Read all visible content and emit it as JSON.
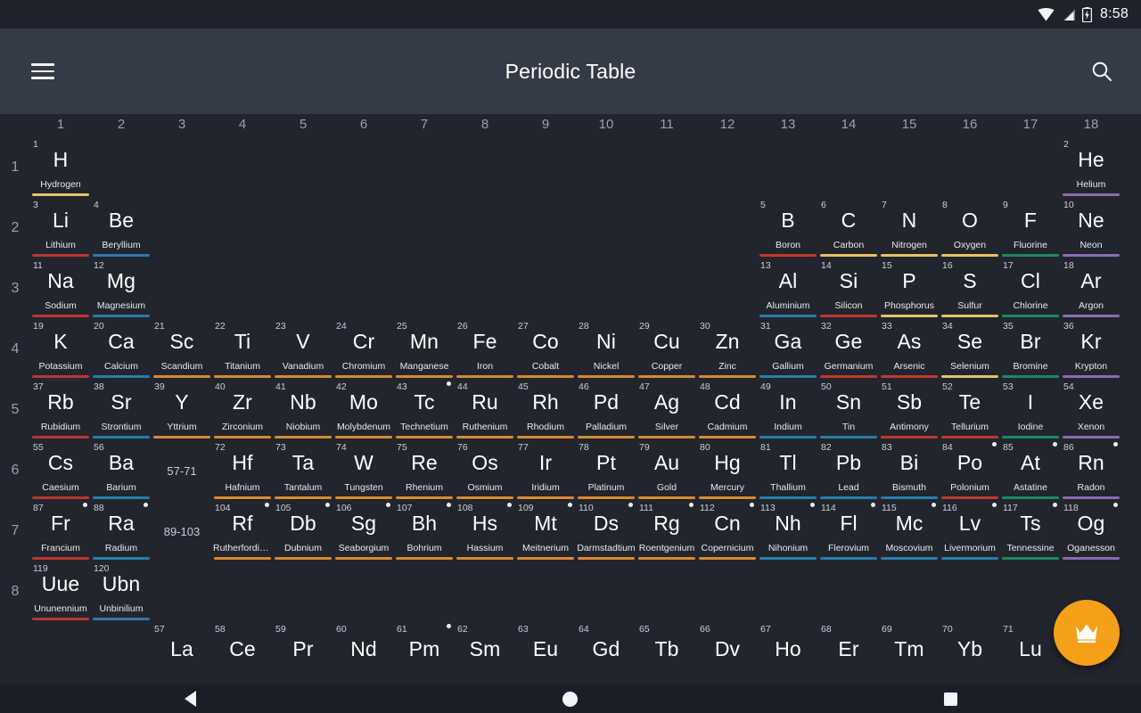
{
  "status_bar": {
    "time": "8:58",
    "icons": [
      "wifi-icon",
      "cell-signal-icon",
      "battery-charging-icon"
    ]
  },
  "app_bar": {
    "title": "Periodic Table",
    "menu_icon": "hamburger-menu-icon",
    "search_icon": "search-icon"
  },
  "fab": {
    "icon": "crown-icon",
    "color": "#f5a019"
  },
  "nav_bar": {
    "back": "back-icon",
    "home": "home-icon",
    "recents": "recents-icon"
  },
  "table": {
    "group_headers": [
      "1",
      "2",
      "3",
      "4",
      "5",
      "6",
      "7",
      "8",
      "9",
      "10",
      "11",
      "12",
      "13",
      "14",
      "15",
      "16",
      "17",
      "18"
    ],
    "period_labels": [
      "1",
      "2",
      "3",
      "4",
      "5",
      "6",
      "7",
      "8"
    ],
    "range_cells": [
      {
        "label": "57-71",
        "period": 6,
        "group": 3
      },
      {
        "label": "89-103",
        "period": 7,
        "group": 3
      }
    ],
    "category_colors": {
      "alkali-metal": "#b8372f",
      "alkaline-earth-metal": "#2b7ba8",
      "transition-metal": "#d68a33",
      "post-transition-metal": "#2b7ba8",
      "metalloid": "#c0392b",
      "nonmetal": "#e3c463",
      "halogen": "#1c8a5e",
      "noble-gas": "#8a6bb0",
      "unknown": "#555b69"
    },
    "elements": [
      {
        "n": 1,
        "sym": "H",
        "name": "Hydrogen",
        "p": 1,
        "g": 1,
        "cat": "nonmetal"
      },
      {
        "n": 2,
        "sym": "He",
        "name": "Helium",
        "p": 1,
        "g": 18,
        "cat": "noble-gas"
      },
      {
        "n": 3,
        "sym": "Li",
        "name": "Lithium",
        "p": 2,
        "g": 1,
        "cat": "alkali-metal"
      },
      {
        "n": 4,
        "sym": "Be",
        "name": "Beryllium",
        "p": 2,
        "g": 2,
        "cat": "alkaline-earth-metal"
      },
      {
        "n": 5,
        "sym": "B",
        "name": "Boron",
        "p": 2,
        "g": 13,
        "cat": "metalloid"
      },
      {
        "n": 6,
        "sym": "C",
        "name": "Carbon",
        "p": 2,
        "g": 14,
        "cat": "nonmetal"
      },
      {
        "n": 7,
        "sym": "N",
        "name": "Nitrogen",
        "p": 2,
        "g": 15,
        "cat": "nonmetal"
      },
      {
        "n": 8,
        "sym": "O",
        "name": "Oxygen",
        "p": 2,
        "g": 16,
        "cat": "nonmetal"
      },
      {
        "n": 9,
        "sym": "F",
        "name": "Fluorine",
        "p": 2,
        "g": 17,
        "cat": "halogen"
      },
      {
        "n": 10,
        "sym": "Ne",
        "name": "Neon",
        "p": 2,
        "g": 18,
        "cat": "noble-gas"
      },
      {
        "n": 11,
        "sym": "Na",
        "name": "Sodium",
        "p": 3,
        "g": 1,
        "cat": "alkali-metal"
      },
      {
        "n": 12,
        "sym": "Mg",
        "name": "Magnesium",
        "p": 3,
        "g": 2,
        "cat": "alkaline-earth-metal"
      },
      {
        "n": 13,
        "sym": "Al",
        "name": "Aluminium",
        "p": 3,
        "g": 13,
        "cat": "post-transition-metal"
      },
      {
        "n": 14,
        "sym": "Si",
        "name": "Silicon",
        "p": 3,
        "g": 14,
        "cat": "metalloid"
      },
      {
        "n": 15,
        "sym": "P",
        "name": "Phosphorus",
        "p": 3,
        "g": 15,
        "cat": "nonmetal"
      },
      {
        "n": 16,
        "sym": "S",
        "name": "Sulfur",
        "p": 3,
        "g": 16,
        "cat": "nonmetal"
      },
      {
        "n": 17,
        "sym": "Cl",
        "name": "Chlorine",
        "p": 3,
        "g": 17,
        "cat": "halogen"
      },
      {
        "n": 18,
        "sym": "Ar",
        "name": "Argon",
        "p": 3,
        "g": 18,
        "cat": "noble-gas"
      },
      {
        "n": 19,
        "sym": "K",
        "name": "Potassium",
        "p": 4,
        "g": 1,
        "cat": "alkali-metal"
      },
      {
        "n": 20,
        "sym": "Ca",
        "name": "Calcium",
        "p": 4,
        "g": 2,
        "cat": "alkaline-earth-metal"
      },
      {
        "n": 21,
        "sym": "Sc",
        "name": "Scandium",
        "p": 4,
        "g": 3,
        "cat": "transition-metal"
      },
      {
        "n": 22,
        "sym": "Ti",
        "name": "Titanium",
        "p": 4,
        "g": 4,
        "cat": "transition-metal"
      },
      {
        "n": 23,
        "sym": "V",
        "name": "Vanadium",
        "p": 4,
        "g": 5,
        "cat": "transition-metal"
      },
      {
        "n": 24,
        "sym": "Cr",
        "name": "Chromium",
        "p": 4,
        "g": 6,
        "cat": "transition-metal"
      },
      {
        "n": 25,
        "sym": "Mn",
        "name": "Manganese",
        "p": 4,
        "g": 7,
        "cat": "transition-metal"
      },
      {
        "n": 26,
        "sym": "Fe",
        "name": "Iron",
        "p": 4,
        "g": 8,
        "cat": "transition-metal"
      },
      {
        "n": 27,
        "sym": "Co",
        "name": "Cobalt",
        "p": 4,
        "g": 9,
        "cat": "transition-metal"
      },
      {
        "n": 28,
        "sym": "Ni",
        "name": "Nickel",
        "p": 4,
        "g": 10,
        "cat": "transition-metal"
      },
      {
        "n": 29,
        "sym": "Cu",
        "name": "Copper",
        "p": 4,
        "g": 11,
        "cat": "transition-metal"
      },
      {
        "n": 30,
        "sym": "Zn",
        "name": "Zinc",
        "p": 4,
        "g": 12,
        "cat": "transition-metal"
      },
      {
        "n": 31,
        "sym": "Ga",
        "name": "Gallium",
        "p": 4,
        "g": 13,
        "cat": "post-transition-metal"
      },
      {
        "n": 32,
        "sym": "Ge",
        "name": "Germanium",
        "p": 4,
        "g": 14,
        "cat": "metalloid"
      },
      {
        "n": 33,
        "sym": "As",
        "name": "Arsenic",
        "p": 4,
        "g": 15,
        "cat": "metalloid"
      },
      {
        "n": 34,
        "sym": "Se",
        "name": "Selenium",
        "p": 4,
        "g": 16,
        "cat": "nonmetal"
      },
      {
        "n": 35,
        "sym": "Br",
        "name": "Bromine",
        "p": 4,
        "g": 17,
        "cat": "halogen"
      },
      {
        "n": 36,
        "sym": "Kr",
        "name": "Krypton",
        "p": 4,
        "g": 18,
        "cat": "noble-gas"
      },
      {
        "n": 37,
        "sym": "Rb",
        "name": "Rubidium",
        "p": 5,
        "g": 1,
        "cat": "alkali-metal"
      },
      {
        "n": 38,
        "sym": "Sr",
        "name": "Strontium",
        "p": 5,
        "g": 2,
        "cat": "alkaline-earth-metal"
      },
      {
        "n": 39,
        "sym": "Y",
        "name": "Yttrium",
        "p": 5,
        "g": 3,
        "cat": "transition-metal"
      },
      {
        "n": 40,
        "sym": "Zr",
        "name": "Zirconium",
        "p": 5,
        "g": 4,
        "cat": "transition-metal"
      },
      {
        "n": 41,
        "sym": "Nb",
        "name": "Niobium",
        "p": 5,
        "g": 5,
        "cat": "transition-metal"
      },
      {
        "n": 42,
        "sym": "Mo",
        "name": "Molybdenum",
        "p": 5,
        "g": 6,
        "cat": "transition-metal"
      },
      {
        "n": 43,
        "sym": "Tc",
        "name": "Technetium",
        "p": 5,
        "g": 7,
        "cat": "transition-metal",
        "rad": true
      },
      {
        "n": 44,
        "sym": "Ru",
        "name": "Ruthenium",
        "p": 5,
        "g": 8,
        "cat": "transition-metal"
      },
      {
        "n": 45,
        "sym": "Rh",
        "name": "Rhodium",
        "p": 5,
        "g": 9,
        "cat": "transition-metal"
      },
      {
        "n": 46,
        "sym": "Pd",
        "name": "Palladium",
        "p": 5,
        "g": 10,
        "cat": "transition-metal"
      },
      {
        "n": 47,
        "sym": "Ag",
        "name": "Silver",
        "p": 5,
        "g": 11,
        "cat": "transition-metal"
      },
      {
        "n": 48,
        "sym": "Cd",
        "name": "Cadmium",
        "p": 5,
        "g": 12,
        "cat": "transition-metal"
      },
      {
        "n": 49,
        "sym": "In",
        "name": "Indium",
        "p": 5,
        "g": 13,
        "cat": "post-transition-metal"
      },
      {
        "n": 50,
        "sym": "Sn",
        "name": "Tin",
        "p": 5,
        "g": 14,
        "cat": "post-transition-metal"
      },
      {
        "n": 51,
        "sym": "Sb",
        "name": "Antimony",
        "p": 5,
        "g": 15,
        "cat": "metalloid"
      },
      {
        "n": 52,
        "sym": "Te",
        "name": "Tellurium",
        "p": 5,
        "g": 16,
        "cat": "metalloid"
      },
      {
        "n": 53,
        "sym": "I",
        "name": "Iodine",
        "p": 5,
        "g": 17,
        "cat": "halogen"
      },
      {
        "n": 54,
        "sym": "Xe",
        "name": "Xenon",
        "p": 5,
        "g": 18,
        "cat": "noble-gas"
      },
      {
        "n": 55,
        "sym": "Cs",
        "name": "Caesium",
        "p": 6,
        "g": 1,
        "cat": "alkali-metal"
      },
      {
        "n": 56,
        "sym": "Ba",
        "name": "Barium",
        "p": 6,
        "g": 2,
        "cat": "alkaline-earth-metal"
      },
      {
        "n": 72,
        "sym": "Hf",
        "name": "Hafnium",
        "p": 6,
        "g": 4,
        "cat": "transition-metal"
      },
      {
        "n": 73,
        "sym": "Ta",
        "name": "Tantalum",
        "p": 6,
        "g": 5,
        "cat": "transition-metal"
      },
      {
        "n": 74,
        "sym": "W",
        "name": "Tungsten",
        "p": 6,
        "g": 6,
        "cat": "transition-metal"
      },
      {
        "n": 75,
        "sym": "Re",
        "name": "Rhenium",
        "p": 6,
        "g": 7,
        "cat": "transition-metal"
      },
      {
        "n": 76,
        "sym": "Os",
        "name": "Osmium",
        "p": 6,
        "g": 8,
        "cat": "transition-metal"
      },
      {
        "n": 77,
        "sym": "Ir",
        "name": "Iridium",
        "p": 6,
        "g": 9,
        "cat": "transition-metal"
      },
      {
        "n": 78,
        "sym": "Pt",
        "name": "Platinum",
        "p": 6,
        "g": 10,
        "cat": "transition-metal"
      },
      {
        "n": 79,
        "sym": "Au",
        "name": "Gold",
        "p": 6,
        "g": 11,
        "cat": "transition-metal"
      },
      {
        "n": 80,
        "sym": "Hg",
        "name": "Mercury",
        "p": 6,
        "g": 12,
        "cat": "transition-metal"
      },
      {
        "n": 81,
        "sym": "Tl",
        "name": "Thallium",
        "p": 6,
        "g": 13,
        "cat": "post-transition-metal"
      },
      {
        "n": 82,
        "sym": "Pb",
        "name": "Lead",
        "p": 6,
        "g": 14,
        "cat": "post-transition-metal"
      },
      {
        "n": 83,
        "sym": "Bi",
        "name": "Bismuth",
        "p": 6,
        "g": 15,
        "cat": "post-transition-metal"
      },
      {
        "n": 84,
        "sym": "Po",
        "name": "Polonium",
        "p": 6,
        "g": 16,
        "cat": "metalloid",
        "rad": true
      },
      {
        "n": 85,
        "sym": "At",
        "name": "Astatine",
        "p": 6,
        "g": 17,
        "cat": "halogen",
        "rad": true
      },
      {
        "n": 86,
        "sym": "Rn",
        "name": "Radon",
        "p": 6,
        "g": 18,
        "cat": "noble-gas",
        "rad": true
      },
      {
        "n": 87,
        "sym": "Fr",
        "name": "Francium",
        "p": 7,
        "g": 1,
        "cat": "alkali-metal",
        "rad": true
      },
      {
        "n": 88,
        "sym": "Ra",
        "name": "Radium",
        "p": 7,
        "g": 2,
        "cat": "alkaline-earth-metal",
        "rad": true
      },
      {
        "n": 104,
        "sym": "Rf",
        "name": "Rutherfordium",
        "p": 7,
        "g": 4,
        "cat": "transition-metal",
        "rad": true
      },
      {
        "n": 105,
        "sym": "Db",
        "name": "Dubnium",
        "p": 7,
        "g": 5,
        "cat": "transition-metal",
        "rad": true
      },
      {
        "n": 106,
        "sym": "Sg",
        "name": "Seaborgium",
        "p": 7,
        "g": 6,
        "cat": "transition-metal",
        "rad": true
      },
      {
        "n": 107,
        "sym": "Bh",
        "name": "Bohrium",
        "p": 7,
        "g": 7,
        "cat": "transition-metal",
        "rad": true
      },
      {
        "n": 108,
        "sym": "Hs",
        "name": "Hassium",
        "p": 7,
        "g": 8,
        "cat": "transition-metal",
        "rad": true
      },
      {
        "n": 109,
        "sym": "Mt",
        "name": "Meitnerium",
        "p": 7,
        "g": 9,
        "cat": "transition-metal",
        "rad": true
      },
      {
        "n": 110,
        "sym": "Ds",
        "name": "Darmstadtium",
        "p": 7,
        "g": 10,
        "cat": "transition-metal",
        "rad": true
      },
      {
        "n": 111,
        "sym": "Rg",
        "name": "Roentgenium",
        "p": 7,
        "g": 11,
        "cat": "transition-metal",
        "rad": true
      },
      {
        "n": 112,
        "sym": "Cn",
        "name": "Copernicium",
        "p": 7,
        "g": 12,
        "cat": "transition-metal",
        "rad": true
      },
      {
        "n": 113,
        "sym": "Nh",
        "name": "Nihonium",
        "p": 7,
        "g": 13,
        "cat": "post-transition-metal",
        "rad": true
      },
      {
        "n": 114,
        "sym": "Fl",
        "name": "Flerovium",
        "p": 7,
        "g": 14,
        "cat": "post-transition-metal",
        "rad": true
      },
      {
        "n": 115,
        "sym": "Mc",
        "name": "Moscovium",
        "p": 7,
        "g": 15,
        "cat": "post-transition-metal",
        "rad": true
      },
      {
        "n": 116,
        "sym": "Lv",
        "name": "Livermorium",
        "p": 7,
        "g": 16,
        "cat": "post-transition-metal",
        "rad": true
      },
      {
        "n": 117,
        "sym": "Ts",
        "name": "Tennessine",
        "p": 7,
        "g": 17,
        "cat": "halogen",
        "rad": true
      },
      {
        "n": 118,
        "sym": "Og",
        "name": "Oganesson",
        "p": 7,
        "g": 18,
        "cat": "noble-gas",
        "rad": true
      },
      {
        "n": 119,
        "sym": "Uue",
        "name": "Ununennium",
        "p": 8,
        "g": 1,
        "cat": "alkali-metal"
      },
      {
        "n": 120,
        "sym": "Ubn",
        "name": "Unbinilium",
        "p": 8,
        "g": 2,
        "cat": "alkaline-earth-metal"
      }
    ],
    "lanthanide_strip": [
      {
        "n": 57,
        "sym": "La",
        "g": 3
      },
      {
        "n": 58,
        "sym": "Ce",
        "g": 4
      },
      {
        "n": 59,
        "sym": "Pr",
        "g": 5
      },
      {
        "n": 60,
        "sym": "Nd",
        "g": 6
      },
      {
        "n": 61,
        "sym": "Pm",
        "g": 7,
        "rad": true
      },
      {
        "n": 62,
        "sym": "Sm",
        "g": 8
      },
      {
        "n": 63,
        "sym": "Eu",
        "g": 9
      },
      {
        "n": 64,
        "sym": "Gd",
        "g": 10
      },
      {
        "n": 65,
        "sym": "Tb",
        "g": 11
      },
      {
        "n": 66,
        "sym": "Dv",
        "g": 12
      },
      {
        "n": 67,
        "sym": "Ho",
        "g": 13
      },
      {
        "n": 68,
        "sym": "Er",
        "g": 14
      },
      {
        "n": 69,
        "sym": "Tm",
        "g": 15
      },
      {
        "n": 70,
        "sym": "Yb",
        "g": 16
      },
      {
        "n": 71,
        "sym": "Lu",
        "g": 17
      }
    ]
  }
}
